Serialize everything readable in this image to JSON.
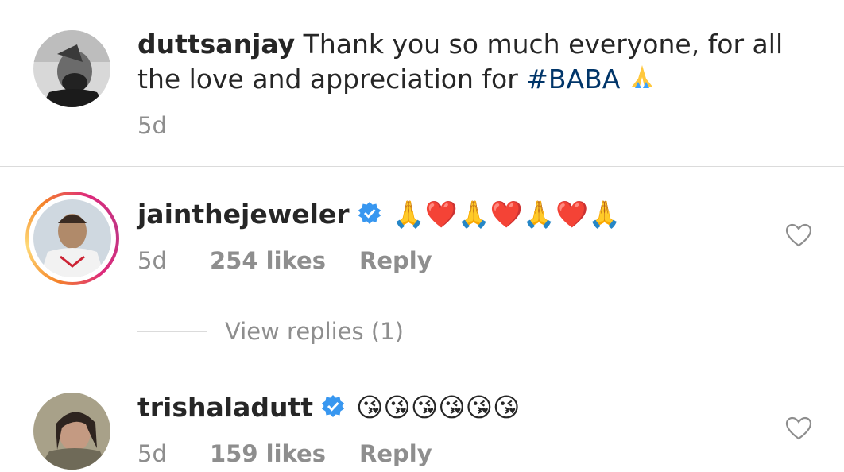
{
  "caption": {
    "username": "duttsanjay",
    "text_line1": "Thank you so much everyone, for all",
    "text_line2_prefix": "the love and appreciation for ",
    "hashtag": "#BABA",
    "time": "5d"
  },
  "comments": [
    {
      "username": "jainthejeweler",
      "verified": true,
      "emoji_text": "🙏❤️🙏❤️🙏❤️🙏",
      "time": "5d",
      "likes": "254 likes",
      "reply": "Reply",
      "view_replies": "View replies (1)"
    },
    {
      "username": "trishaladutt",
      "verified": true,
      "emoji_text": "😘😘😘😘😘😘",
      "time": "5d",
      "likes": "159 likes",
      "reply": "Reply"
    }
  ],
  "colors": {
    "text": "#262626",
    "muted": "#8e8e8e",
    "hashtag": "#003569",
    "verified": "#3897f0",
    "divider": "#dbdbdb"
  },
  "icons": [
    "pray-emoji",
    "red-heart-emoji",
    "kiss-emoji",
    "verified-badge-icon",
    "heart-outline-icon"
  ]
}
